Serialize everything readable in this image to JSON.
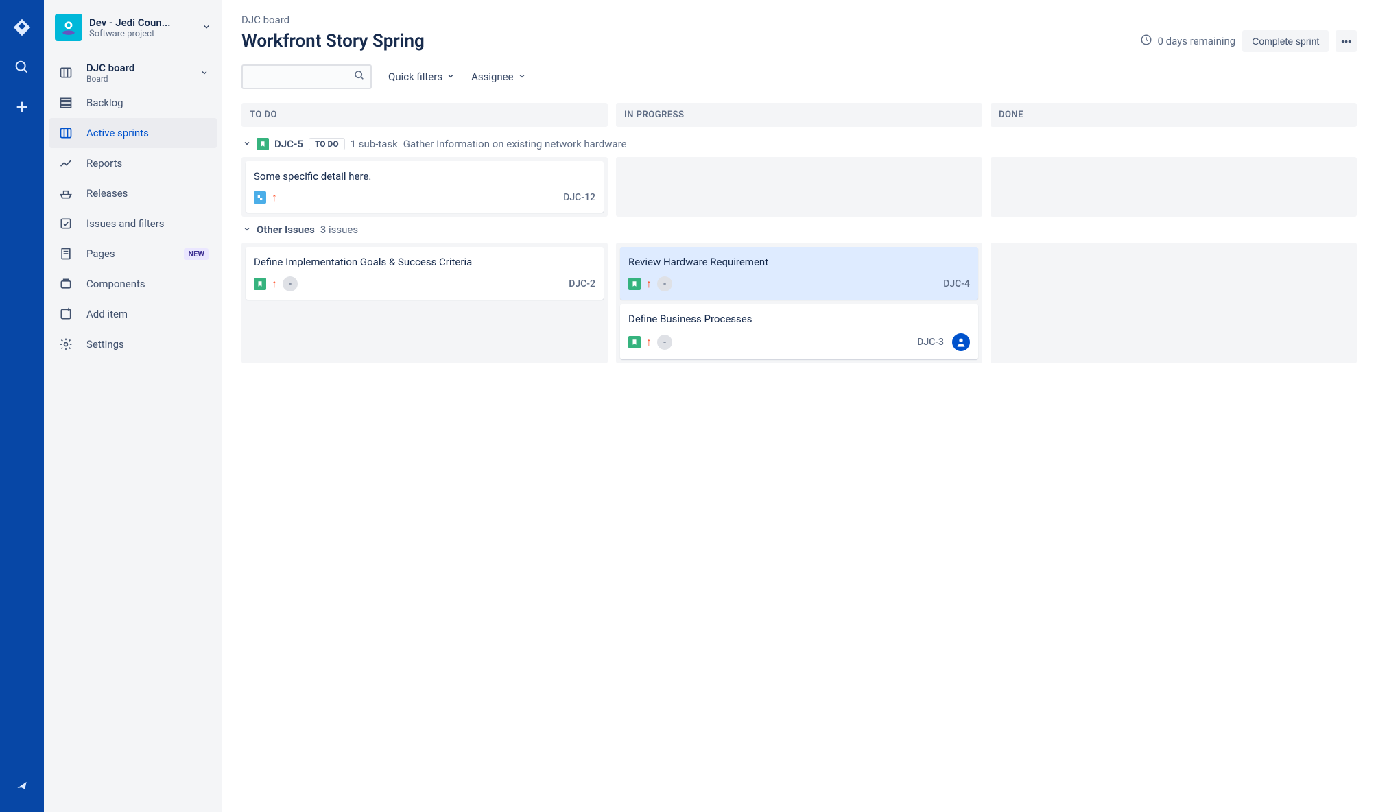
{
  "rail": {
    "icons": [
      "jira-logo",
      "search",
      "create"
    ],
    "bottom_icons": [
      "notifications",
      "help"
    ]
  },
  "sidebar": {
    "project_name": "Dev - Jedi Coun...",
    "project_type": "Software project",
    "board_section": {
      "title": "DJC board",
      "subtitle": "Board"
    },
    "items": [
      {
        "label": "Backlog",
        "icon": "backlog"
      },
      {
        "label": "Active sprints",
        "icon": "board",
        "active": true
      },
      {
        "label": "Reports",
        "icon": "reports"
      },
      {
        "label": "Releases",
        "icon": "ship"
      },
      {
        "label": "Issues and filters",
        "icon": "filter"
      },
      {
        "label": "Pages",
        "icon": "page",
        "badge": "NEW"
      },
      {
        "label": "Components",
        "icon": "component"
      },
      {
        "label": "Add item",
        "icon": "add"
      },
      {
        "label": "Settings",
        "icon": "settings"
      }
    ]
  },
  "header": {
    "breadcrumb": "DJC board",
    "title": "Workfront Story Spring",
    "remaining": "0 days remaining",
    "complete_label": "Complete sprint"
  },
  "toolbar": {
    "search_placeholder": "",
    "quick_filters": "Quick filters",
    "assignee": "Assignee"
  },
  "board": {
    "columns": [
      "TO DO",
      "IN PROGRESS",
      "DONE"
    ],
    "swimlanes": [
      {
        "key": "DJC-5",
        "status": "TO DO",
        "subtasks_label": "1 sub-task",
        "title": "Gather Information on existing network hardware",
        "columns": [
          [
            {
              "title": "Some specific detail here.",
              "key": "DJC-12",
              "type": "subtask",
              "priority": "major"
            }
          ],
          [],
          []
        ]
      },
      {
        "title": "Other Issues",
        "count_label": "3 issues",
        "columns": [
          [
            {
              "title": "Define Implementation Goals & Success Criteria",
              "key": "DJC-2",
              "type": "story",
              "priority": "major",
              "unassigned": true
            }
          ],
          [
            {
              "title": "Review Hardware Requirement",
              "key": "DJC-4",
              "type": "story",
              "priority": "major",
              "unassigned": true,
              "highlight": true
            },
            {
              "title": "Define Business Processes",
              "key": "DJC-3",
              "type": "story",
              "priority": "major",
              "unassigned": true,
              "assignee_avatar": true
            }
          ],
          []
        ]
      }
    ]
  }
}
